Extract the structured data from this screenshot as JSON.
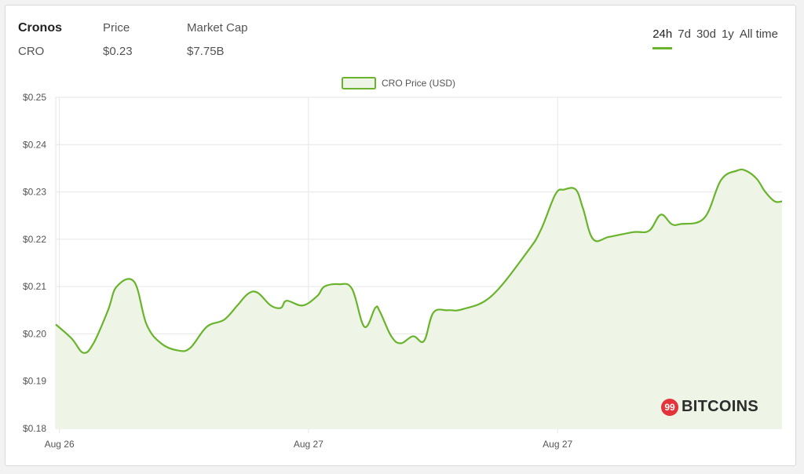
{
  "header": {
    "coin_name": "Cronos",
    "coin_symbol": "CRO",
    "price_label": "Price",
    "price_value": "$0.23",
    "mcap_label": "Market Cap",
    "mcap_value": "$7.75B"
  },
  "ranges": [
    {
      "label": "24h",
      "active": true
    },
    {
      "label": "7d",
      "active": false
    },
    {
      "label": "30d",
      "active": false
    },
    {
      "label": "1y",
      "active": false
    },
    {
      "label": "All time",
      "active": false
    }
  ],
  "colors": {
    "line": "#6ab42d",
    "fill": "#eef5e6",
    "grid": "#e6e6e6"
  },
  "logo": {
    "badge_text": "99",
    "text": "BITCOINS"
  },
  "chart_data": {
    "type": "area",
    "legend": "CRO Price (USD)",
    "legend_position": "top-center",
    "grid": true,
    "ylim": [
      0.18,
      0.25
    ],
    "yticks": [
      0.25,
      0.24,
      0.23,
      0.22,
      0.21,
      0.2,
      0.19,
      0.18
    ],
    "ytick_labels": [
      "$0.25",
      "$0.24",
      "$0.23",
      "$0.22",
      "$0.21",
      "$0.20",
      "$0.19",
      "$0.18"
    ],
    "xlim": [
      0,
      1
    ],
    "xticks": [
      {
        "label": "Aug 26",
        "x": 0.005
      },
      {
        "label": "Aug 27",
        "x": 0.348
      },
      {
        "label": "Aug 27",
        "x": 0.691
      }
    ],
    "x": [
      0.0,
      0.022,
      0.038,
      0.052,
      0.072,
      0.084,
      0.108,
      0.125,
      0.145,
      0.168,
      0.185,
      0.208,
      0.232,
      0.25,
      0.265,
      0.278,
      0.296,
      0.31,
      0.318,
      0.34,
      0.36,
      0.37,
      0.39,
      0.408,
      0.425,
      0.44,
      0.446,
      0.462,
      0.475,
      0.492,
      0.507,
      0.52,
      0.54,
      0.56,
      0.6,
      0.65,
      0.668,
      0.688,
      0.7,
      0.716,
      0.726,
      0.74,
      0.762,
      0.795,
      0.817,
      0.833,
      0.848,
      0.86,
      0.893,
      0.916,
      0.938,
      0.95,
      0.965,
      0.977,
      0.99,
      1.0
    ],
    "values": [
      0.202,
      0.199,
      0.196,
      0.198,
      0.205,
      0.21,
      0.211,
      0.202,
      0.198,
      0.1965,
      0.197,
      0.2015,
      0.203,
      0.206,
      0.2085,
      0.2087,
      0.206,
      0.2055,
      0.207,
      0.206,
      0.208,
      0.21,
      0.2105,
      0.2095,
      0.2015,
      0.2055,
      0.2048,
      0.1995,
      0.198,
      0.1995,
      0.1985,
      0.2045,
      0.205,
      0.2052,
      0.208,
      0.2175,
      0.222,
      0.2295,
      0.2305,
      0.2305,
      0.2265,
      0.22,
      0.2205,
      0.2215,
      0.2218,
      0.2252,
      0.2232,
      0.2232,
      0.2245,
      0.2325,
      0.2345,
      0.2345,
      0.2328,
      0.23,
      0.228,
      0.228
    ]
  }
}
